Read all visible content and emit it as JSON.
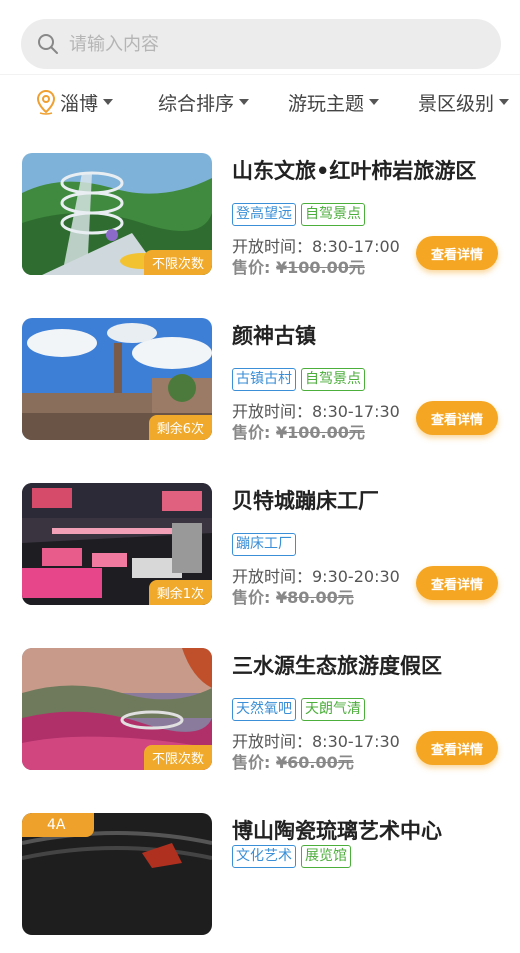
{
  "search": {
    "placeholder": "请输入内容"
  },
  "filters": {
    "city": "淄博",
    "sort": "综合排序",
    "theme": "游玩主题",
    "level": "景区级别"
  },
  "labels": {
    "details_button": "查看详情"
  },
  "items": [
    {
      "name": "山东文旅•红叶柿岩旅游区",
      "tags": [
        {
          "text": "登高望远",
          "color": "blue"
        },
        {
          "text": "自驾景点",
          "color": "green"
        }
      ],
      "hours": "开放时间：8:30-17:00",
      "price_label": "售价:",
      "price": "¥100.00元",
      "remaining": "不限次数"
    },
    {
      "name": "颜神古镇",
      "tags": [
        {
          "text": "古镇古村",
          "color": "blue"
        },
        {
          "text": "自驾景点",
          "color": "green"
        }
      ],
      "hours": "开放时间：8:30-17:30",
      "price_label": "售价:",
      "price": "¥100.00元",
      "remaining": "剩余6次"
    },
    {
      "name": "贝特城蹦床工厂",
      "tags": [
        {
          "text": "蹦床工厂",
          "color": "blue"
        }
      ],
      "hours": "开放时间：9:30-20:30",
      "price_label": "售价:",
      "price": "¥80.00元",
      "remaining": "剩余1次"
    },
    {
      "name": "三水源生态旅游度假区",
      "tags": [
        {
          "text": "天然氧吧",
          "color": "blue"
        },
        {
          "text": "天朗气清",
          "color": "green"
        }
      ],
      "hours": "开放时间：8:30-17:30",
      "price_label": "售价:",
      "price": "¥60.00元",
      "remaining": "不限次数"
    },
    {
      "name": "博山陶瓷琉璃艺术中心",
      "level": "4A",
      "tags": [
        {
          "text": "文化艺术",
          "color": "blue"
        },
        {
          "text": "展览馆",
          "color": "green"
        }
      ]
    }
  ]
}
